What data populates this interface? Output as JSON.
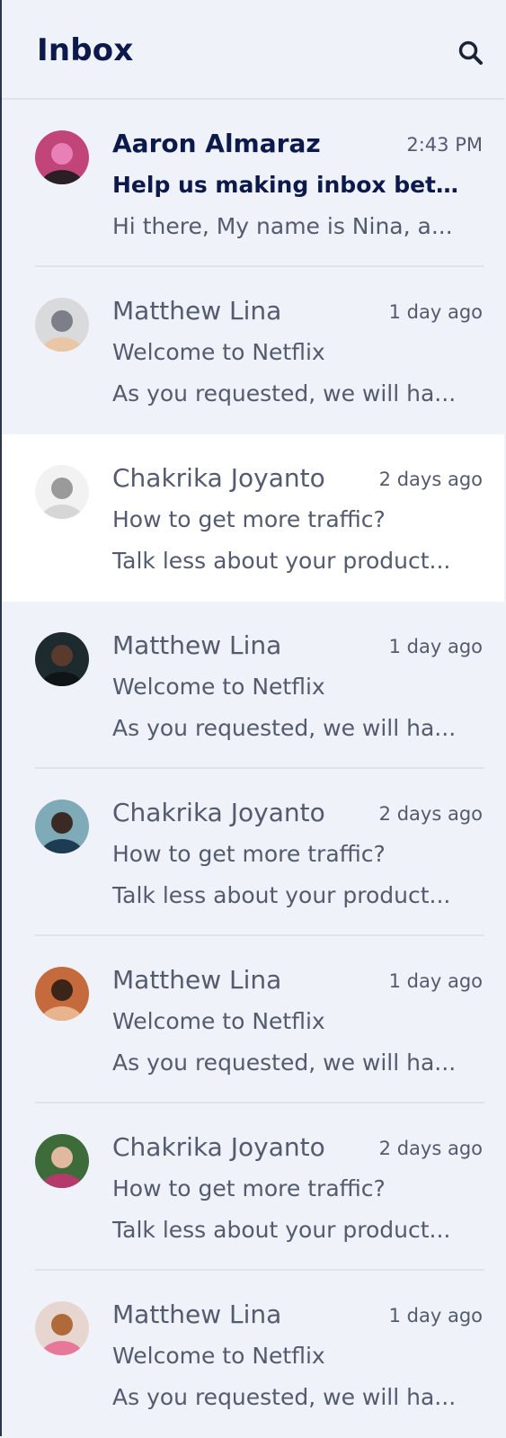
{
  "header": {
    "title": "Inbox",
    "search_icon": "search-icon"
  },
  "messages": [
    {
      "sender": "Aaron Almaraz",
      "time": "2:43 PM",
      "subject": "Help us making inbox better...",
      "preview": "Hi there, My name is Nina, a...",
      "unread": true,
      "avatar_colors": [
        "#c2457a",
        "#e87fb6",
        "#2a1f24"
      ]
    },
    {
      "sender": "Matthew Lina",
      "time": "1 day ago",
      "subject": "Welcome to Netflix",
      "preview": "As you requested, we will ha...",
      "unread": false,
      "avatar_colors": [
        "#d9dadc",
        "#7b7f87",
        "#e9c6a5"
      ]
    },
    {
      "sender": "Chakrika Joyanto",
      "time": "2 days ago",
      "subject": "How to get more traffic?",
      "preview": "Talk less about your product...",
      "unread": false,
      "selected": true,
      "avatar_colors": [
        "#f2f2f2",
        "#9a9a9a",
        "#d6d6d6"
      ]
    },
    {
      "sender": "Matthew Lina",
      "time": "1 day ago",
      "subject": "Welcome to Netflix",
      "preview": "As you requested, we will ha...",
      "unread": false,
      "avatar_colors": [
        "#1d2a2e",
        "#5a3a2c",
        "#0f1416"
      ]
    },
    {
      "sender": "Chakrika Joyanto",
      "time": "2 days ago",
      "subject": "How to get more traffic?",
      "preview": "Talk less about your product...",
      "unread": false,
      "avatar_colors": [
        "#7faab8",
        "#3b2a24",
        "#1d3b52"
      ]
    },
    {
      "sender": "Matthew Lina",
      "time": "1 day ago",
      "subject": "Welcome to Netflix",
      "preview": "As you requested, we will ha...",
      "unread": false,
      "avatar_colors": [
        "#c56a3c",
        "#3b2418",
        "#e8b48e"
      ]
    },
    {
      "sender": "Chakrika Joyanto",
      "time": "2 days ago",
      "subject": "How to get more traffic?",
      "preview": "Talk less about your product...",
      "unread": false,
      "avatar_colors": [
        "#3e6b3a",
        "#e0b9a0",
        "#b43a6a"
      ]
    },
    {
      "sender": "Matthew Lina",
      "time": "1 day ago",
      "subject": "Welcome to Netflix",
      "preview": "As you requested, we will ha...",
      "unread": false,
      "avatar_colors": [
        "#e7d6cf",
        "#b06a3a",
        "#e8789a"
      ]
    }
  ]
}
